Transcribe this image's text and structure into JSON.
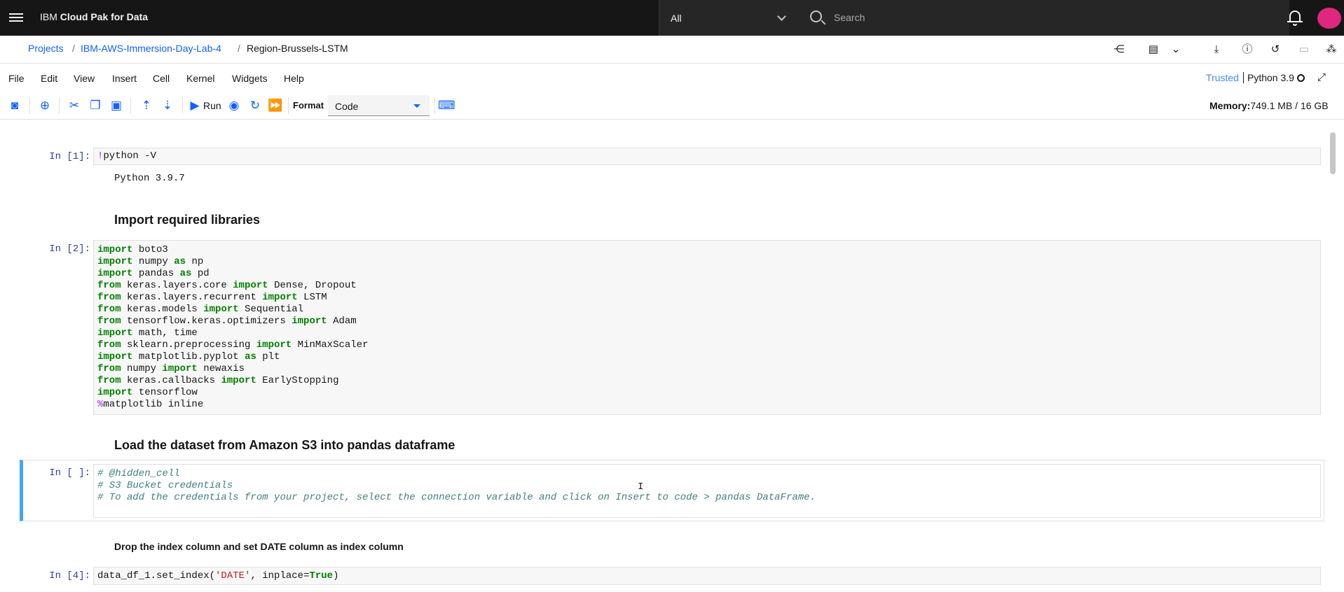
{
  "header": {
    "brand_prefix": "IBM",
    "brand_name": "Cloud Pak for Data",
    "scope_value": "All",
    "search_placeholder": "Search"
  },
  "breadcrumb": {
    "items": [
      "Projects",
      "/",
      "IBM-AWS-Immersion-Day-Lab-4",
      "/",
      "Region-Brussels-LSTM"
    ]
  },
  "menubar": {
    "items": [
      "File",
      "Edit",
      "View",
      "Insert",
      "Cell",
      "Kernel",
      "Widgets",
      "Help"
    ],
    "trusted": "Trusted",
    "kernel": "Python 3.9"
  },
  "toolbar": {
    "run_label": "Run",
    "format_label": "Format",
    "format_value": "Code",
    "memory_label": "Memory:",
    "memory_value": "749.1 MB / 16 GB"
  },
  "cells": {
    "c1": {
      "prompt": "In [1]:",
      "output": "Python 3.9.7"
    },
    "md1": "Import required libraries",
    "c2": {
      "prompt": "In [2]:"
    },
    "md2": "Load the dataset from Amazon S3 into pandas dataframe",
    "c3": {
      "prompt": "In [ ]:"
    },
    "md3": "Drop the index column and set DATE column as index column",
    "c4": {
      "prompt": "In [4]:"
    }
  },
  "colors": {
    "topbar": "#161616",
    "link": "#0f62fe",
    "keyword": "#008000",
    "selected_cell": "#42a5f5",
    "avatar": "#e0277f"
  }
}
